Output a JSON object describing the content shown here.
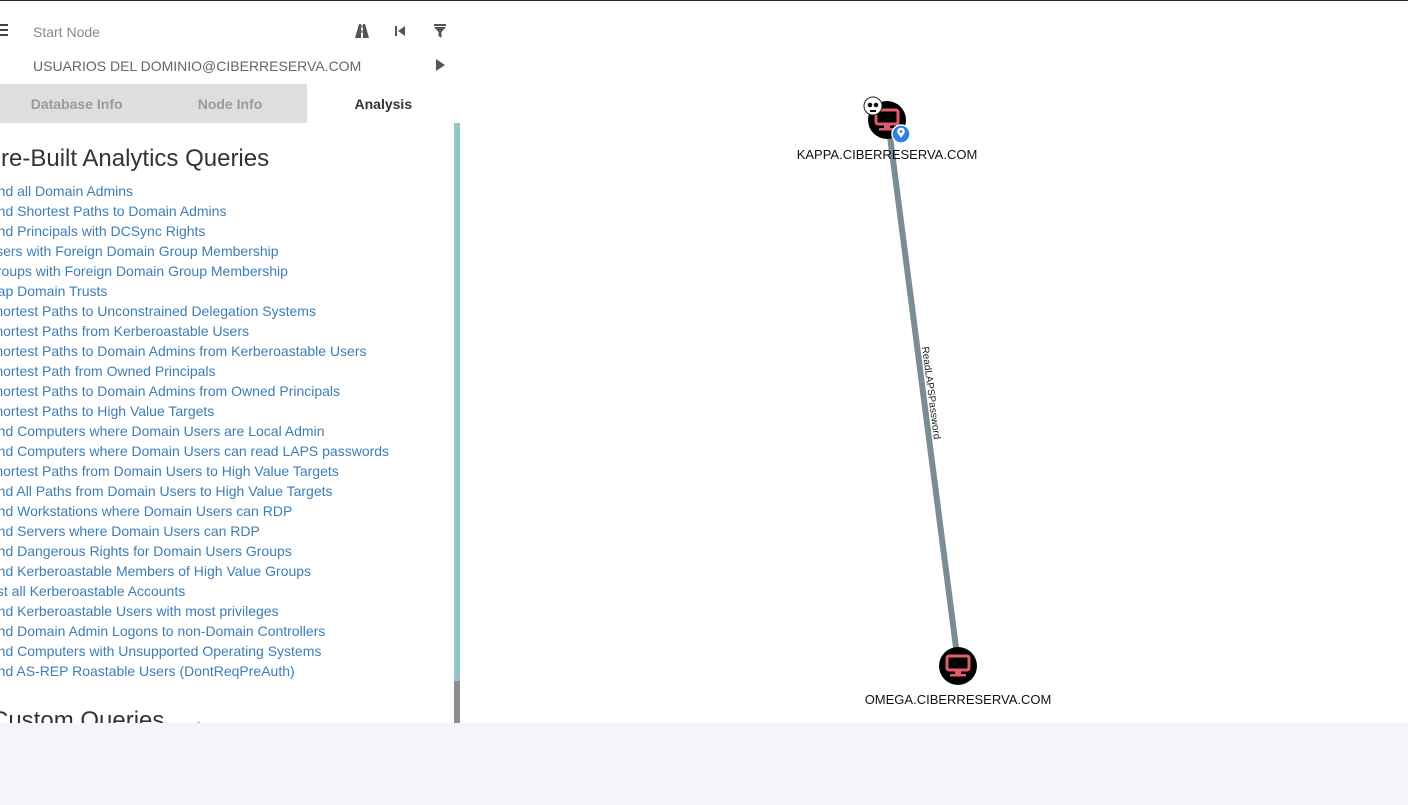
{
  "search": {
    "start_placeholder": "Start Node",
    "target_value": "USUARIOS DEL DOMINIO@CIBERRESERVA.COM"
  },
  "toolbar": {
    "path_icon": "road-icon",
    "back_icon": "skip-back-icon",
    "filter_icon": "filter-icon",
    "play_icon": "play-icon",
    "menu_icon": "hamburger-menu-icon"
  },
  "tabs": [
    {
      "label": "Database Info",
      "active": false
    },
    {
      "label": "Node Info",
      "active": false
    },
    {
      "label": "Analysis",
      "active": true
    }
  ],
  "analysis": {
    "prebuilt_title": "Pre-Built Analytics Queries",
    "queries": [
      "Find all Domain Admins",
      "Find Shortest Paths to Domain Admins",
      "Find Principals with DCSync Rights",
      "Users with Foreign Domain Group Membership",
      "Groups with Foreign Domain Group Membership",
      "Map Domain Trusts",
      "Shortest Paths to Unconstrained Delegation Systems",
      "Shortest Paths from Kerberoastable Users",
      "Shortest Paths to Domain Admins from Kerberoastable Users",
      "Shortest Path from Owned Principals",
      "Shortest Paths to Domain Admins from Owned Principals",
      "Shortest Paths to High Value Targets",
      "Find Computers where Domain Users are Local Admin",
      "Find Computers where Domain Users can read LAPS passwords",
      "Shortest Paths from Domain Users to High Value Targets",
      "Find All Paths from Domain Users to High Value Targets",
      "Find Workstations where Domain Users can RDP",
      "Find Servers where Domain Users can RDP",
      "Find Dangerous Rights for Domain Users Groups",
      "Find Kerberoastable Members of High Value Groups",
      "List all Kerberoastable Accounts",
      "Find Kerberoastable Users with most privileges",
      "Find Domain Admin Logons to non-Domain Controllers",
      "Find Computers with Unsupported Operating Systems",
      "Find AS-REP Roastable Users (DontReqPreAuth)"
    ],
    "custom_title": "Custom Queries",
    "custom_icons": [
      "pencil-icon",
      "refresh-icon"
    ]
  },
  "graph": {
    "nodes": [
      {
        "label": "KAPPA.CIBERRESERVA.COM",
        "icon": "computer-icon",
        "badges": [
          "skull-icon",
          "location-pin-icon"
        ]
      },
      {
        "label": "OMEGA.CIBERRESERVA.COM",
        "icon": "computer-icon",
        "badges": []
      }
    ],
    "edge_label": "ReadLAPSPassword",
    "colors": {
      "node_fill": "#000000",
      "computer_icon": "#e05c6a",
      "edge": "#7a8d95",
      "pin": "#2f7ee0",
      "link": "#3d7eb6"
    }
  }
}
